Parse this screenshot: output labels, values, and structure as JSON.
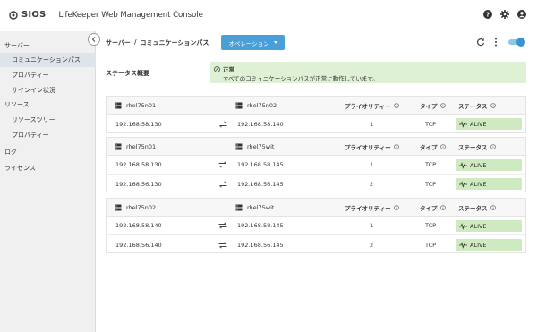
{
  "app": {
    "logo_text": "SIOS",
    "title": "LifeKeeper Web Management Console"
  },
  "sidebar": {
    "items": [
      {
        "label": "サーバー",
        "level": "top",
        "active": false
      },
      {
        "label": "コミュニケーションパス",
        "level": "sub",
        "active": true
      },
      {
        "label": "プロパティー",
        "level": "sub",
        "active": false
      },
      {
        "label": "サインイン状況",
        "level": "sub",
        "active": false
      },
      {
        "label": "リソース",
        "level": "top",
        "active": false
      },
      {
        "label": "リソースツリー",
        "level": "sub",
        "active": false
      },
      {
        "label": "プロパティー",
        "level": "sub",
        "active": false
      },
      {
        "label": "ログ",
        "level": "top",
        "active": false
      },
      {
        "label": "ライセンス",
        "level": "top",
        "active": false
      }
    ]
  },
  "breadcrumb": {
    "root": "サーバー",
    "sep": "/",
    "current": "コミュニケーションパス"
  },
  "operations_label": "オペレーション",
  "summary": {
    "label": "ステータス概要",
    "title": "正常",
    "description": "すべてのコミュニケーションパスが正常に動作しています。"
  },
  "columns": {
    "priority": "プライオリティー",
    "type": "タイプ",
    "status": "ステータス"
  },
  "cards": [
    {
      "server_a": "rhel75n01",
      "server_b": "rhel75n02",
      "rows": [
        {
          "ip_a": "192.168.58.130",
          "ip_b": "192.168.58.140",
          "priority": "1",
          "type": "TCP",
          "status": "ALIVE"
        }
      ]
    },
    {
      "server_a": "rhel75n01",
      "server_b": "rhel75wit",
      "rows": [
        {
          "ip_a": "192.168.58.130",
          "ip_b": "192.168.58.145",
          "priority": "1",
          "type": "TCP",
          "status": "ALIVE"
        },
        {
          "ip_a": "192.168.56.130",
          "ip_b": "192.168.56.145",
          "priority": "2",
          "type": "TCP",
          "status": "ALIVE"
        }
      ]
    },
    {
      "server_a": "rhel75n02",
      "server_b": "rhel75wit",
      "rows": [
        {
          "ip_a": "192.168.58.140",
          "ip_b": "192.168.58.145",
          "priority": "1",
          "type": "TCP",
          "status": "ALIVE"
        },
        {
          "ip_a": "192.168.56.140",
          "ip_b": "192.168.56.145",
          "priority": "2",
          "type": "TCP",
          "status": "ALIVE"
        }
      ]
    }
  ],
  "icons": {
    "help": "help-icon",
    "settings": "gear-icon",
    "user": "user-icon",
    "refresh": "refresh-icon",
    "more": "kebab-menu-icon",
    "server": "server-icon",
    "swap": "bidirectional-arrow-icon",
    "alive": "heartbeat-icon",
    "info": "info-icon"
  },
  "colors": {
    "accent": "#4a9fd8",
    "ok_bg": "#dff1d5",
    "alive_bg": "#cfeac0",
    "sidebar_bg": "#f0f0f0"
  }
}
